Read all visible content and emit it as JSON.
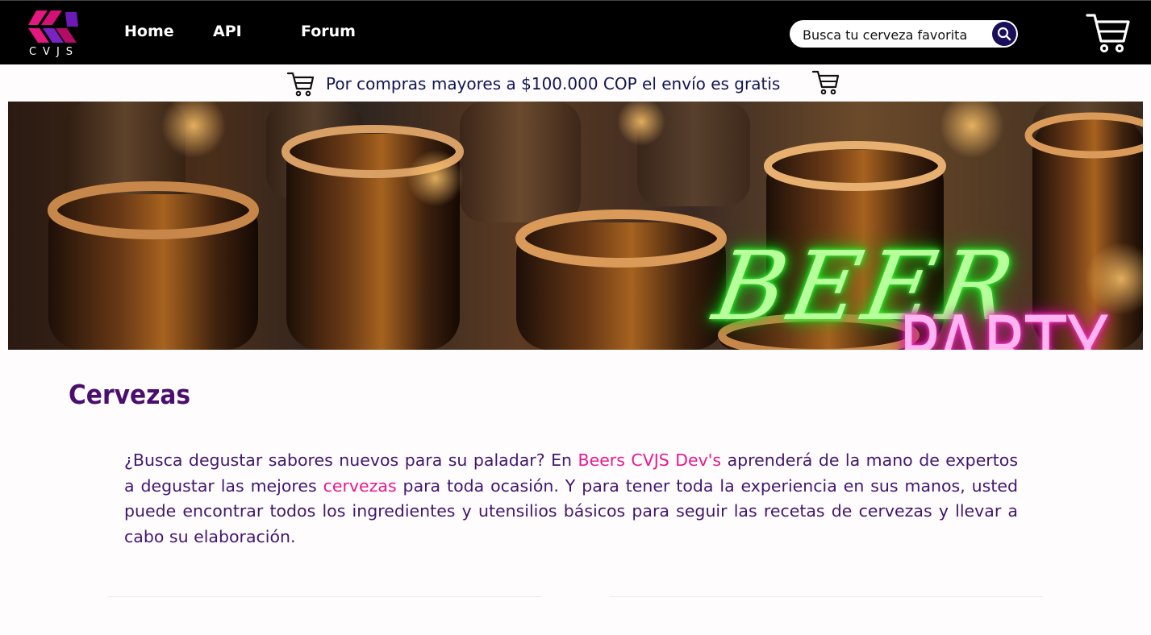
{
  "brand": {
    "logo_text": "CVJS"
  },
  "nav": {
    "links": [
      "Home",
      "API",
      "Forum"
    ],
    "search_placeholder": "Busca tu cerveza favorita"
  },
  "promo": {
    "text": "Por compras mayores a $100.000 COP el envío es gratis"
  },
  "banner": {
    "line1": "BEER",
    "line2": "PARTY"
  },
  "content": {
    "title": "Cervezas",
    "p_before": "¿Busca degustar sabores nuevos para su paladar? En ",
    "p_hl1": "Beers CVJS Dev's",
    "p_mid": " aprenderá de la mano de expertos a degustar las mejores ",
    "p_hl2": "cervezas",
    "p_after": " para toda ocasión. Y para tener toda la experiencia en sus manos, usted puede encontrar todos los ingredientes y utensilios básicos para seguir las recetas de cervezas y llevar a cabo su elaboración."
  },
  "colors": {
    "accent_pink": "#e7198f",
    "title_purple": "#4a0f6d",
    "search_button": "#1b0e58"
  },
  "icons": [
    "cvjs-logo-icon",
    "search-icon",
    "shopping-cart-icon"
  ]
}
